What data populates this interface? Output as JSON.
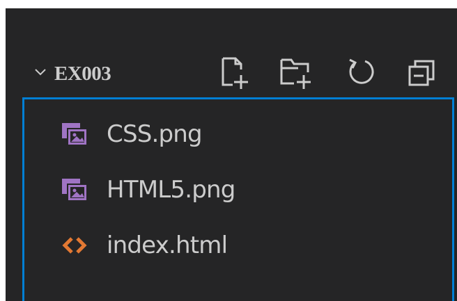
{
  "explorer": {
    "section_title": "EX003",
    "actions": [
      {
        "icon": "new-file-icon"
      },
      {
        "icon": "new-folder-icon"
      },
      {
        "icon": "refresh-icon"
      },
      {
        "icon": "collapse-all-icon"
      }
    ],
    "files": [
      {
        "label": "CSS.png",
        "icon": "image-file-icon",
        "icon_color": "#a074c4"
      },
      {
        "label": "HTML5.png",
        "icon": "image-file-icon",
        "icon_color": "#a074c4"
      },
      {
        "label": "index.html",
        "icon": "html-file-icon",
        "icon_color": "#e37933"
      }
    ]
  },
  "colors": {
    "panel_bg": "#252526",
    "text": "#cccccc",
    "focus_border": "#007fd4"
  }
}
